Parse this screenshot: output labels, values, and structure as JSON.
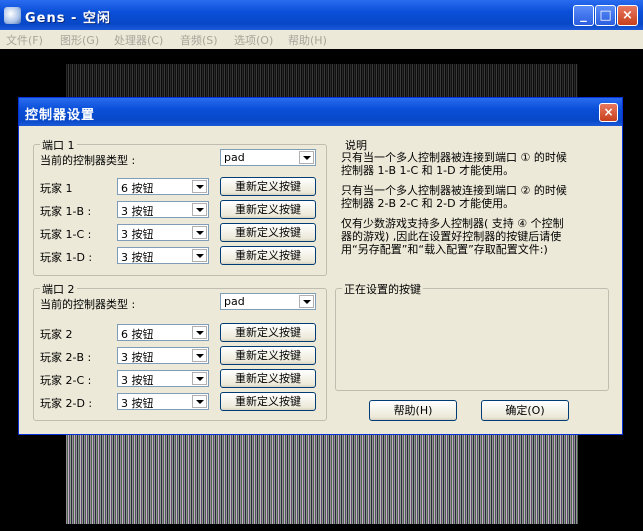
{
  "main_window": {
    "title": "Gens - 空闲",
    "minimize": "_",
    "maximize": "□",
    "close": "×"
  },
  "menu": [
    "文件(F)",
    "图形(G)",
    "处理器(C)",
    "音频(S)",
    "选项(O)",
    "帮助(H)"
  ],
  "dialog": {
    "title": "控制器设置",
    "close": "×",
    "port1": {
      "label": "端口 1",
      "type_label": "当前的控制器类型 :",
      "type_value": "pad",
      "players": [
        {
          "label": "玩家 1",
          "value": "6 按钮",
          "button": "重新定义按键"
        },
        {
          "label": "玩家 1-B :",
          "value": "3 按钮",
          "button": "重新定义按键"
        },
        {
          "label": "玩家 1-C :",
          "value": "3 按钮",
          "button": "重新定义按键"
        },
        {
          "label": "玩家 1-D :",
          "value": "3 按钮",
          "button": "重新定义按键"
        }
      ]
    },
    "port2": {
      "label": "端口 2",
      "type_label": "当前的控制器类型 :",
      "type_value": "pad",
      "players": [
        {
          "label": "玩家 2",
          "value": "6 按钮",
          "button": "重新定义按键"
        },
        {
          "label": "玩家 2-B :",
          "value": "3 按钮",
          "button": "重新定义按键"
        },
        {
          "label": "玩家 2-C :",
          "value": "3 按钮",
          "button": "重新定义按键"
        },
        {
          "label": "玩家 2-D :",
          "value": "3 按钮",
          "button": "重新定义按键"
        }
      ]
    },
    "notes": {
      "label": "说明",
      "lines": [
        "只有当一个多人控制器被连接到端口 ① 的时候",
        "控制器 1-B 1-C 和 1-D 才能使用。",
        "只有当一个多人控制器被连接到端口 ② 的时候",
        "控制器 2-B 2-C 和 2-D 才能使用。",
        "仅有少数游戏支持多人控制器( 支持 ④ 个控制",
        "器的游戏) ,因此在设置好控制器的按键后请使",
        "用“另存配置”和“载入配置”存取配置文件:)"
      ]
    },
    "current_setting_label": "正在设置的按键",
    "help_button": "帮助(H)",
    "ok_button": "确定(O)"
  },
  "colors": {
    "titlebar": "#0a4fd8",
    "dialog_bg": "#ece9d8",
    "close_red": "#c8401c"
  }
}
